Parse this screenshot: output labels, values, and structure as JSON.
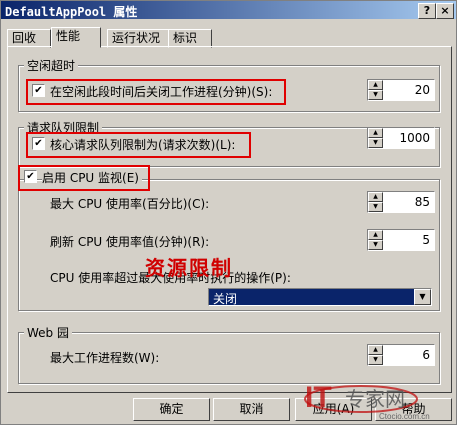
{
  "window": {
    "title": "DefaultAppPool 属性",
    "help_btn": "?",
    "close_btn": "×"
  },
  "tabs": [
    "回收",
    "性能",
    "运行状况",
    "标识"
  ],
  "active_tab": 1,
  "idle": {
    "group": "空闲超时",
    "checkbox_label": "在空闲此段时间后关闭工作进程(分钟)(S):",
    "checked": true,
    "value": "20"
  },
  "queue": {
    "group": "请求队列限制",
    "checkbox_label": "核心请求队列限制为(请求次数)(L):",
    "checked": true,
    "value": "1000"
  },
  "cpu": {
    "checkbox_label": "启用 CPU 监视(E)",
    "checked": true,
    "max_label": "最大 CPU 使用率(百分比)(C):",
    "max_value": "85",
    "refresh_label": "刷新 CPU 使用率值(分钟)(R):",
    "refresh_value": "5",
    "action_label": "CPU 使用率超过最大使用率时执行的操作(P):",
    "action_selected": "关闭"
  },
  "annotation": "资源限制",
  "webgarden": {
    "group": "Web 园",
    "max_processes_label": "最大工作进程数(W):",
    "max_processes_value": "6"
  },
  "buttons": {
    "ok": "确定",
    "cancel": "取消",
    "apply": "应用(A)",
    "help": "帮助"
  },
  "watermark": {
    "logo": "IT专家网",
    "site": "Ctocio.com.cn"
  },
  "colors": {
    "titlebar": "#0a246a",
    "highlight": "#e00000",
    "face": "#d4d0c8"
  }
}
